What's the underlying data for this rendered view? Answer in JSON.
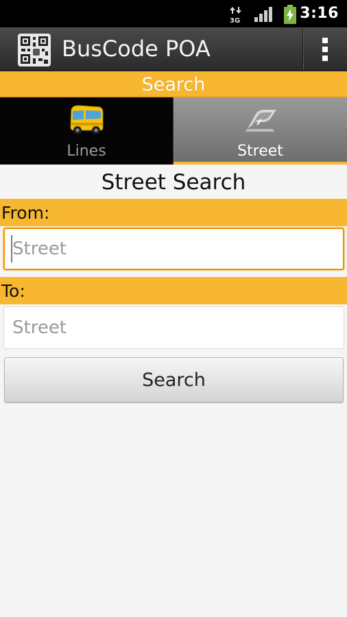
{
  "status_bar": {
    "network_type": "3G",
    "time": "3:16",
    "icons": [
      "network-activity-icon",
      "signal-icon",
      "battery-charging-icon"
    ]
  },
  "app_bar": {
    "title": "BusCode POA",
    "logo_icon": "qr-code-icon",
    "overflow_icon": "overflow-menu-icon"
  },
  "search_header": "Search",
  "tabs": [
    {
      "label": "Lines",
      "icon": "bus-icon",
      "selected": false
    },
    {
      "label": "Street",
      "icon": "road-icon",
      "selected": true
    }
  ],
  "form": {
    "title": "Street Search",
    "from_label": "From:",
    "from_placeholder": "Street",
    "from_value": "",
    "to_label": "To:",
    "to_placeholder": "Street",
    "to_value": "",
    "search_button": "Search"
  },
  "colors": {
    "accent": "#f7b731",
    "focus": "#f08c00",
    "app_bar": "#3a3a3a"
  }
}
